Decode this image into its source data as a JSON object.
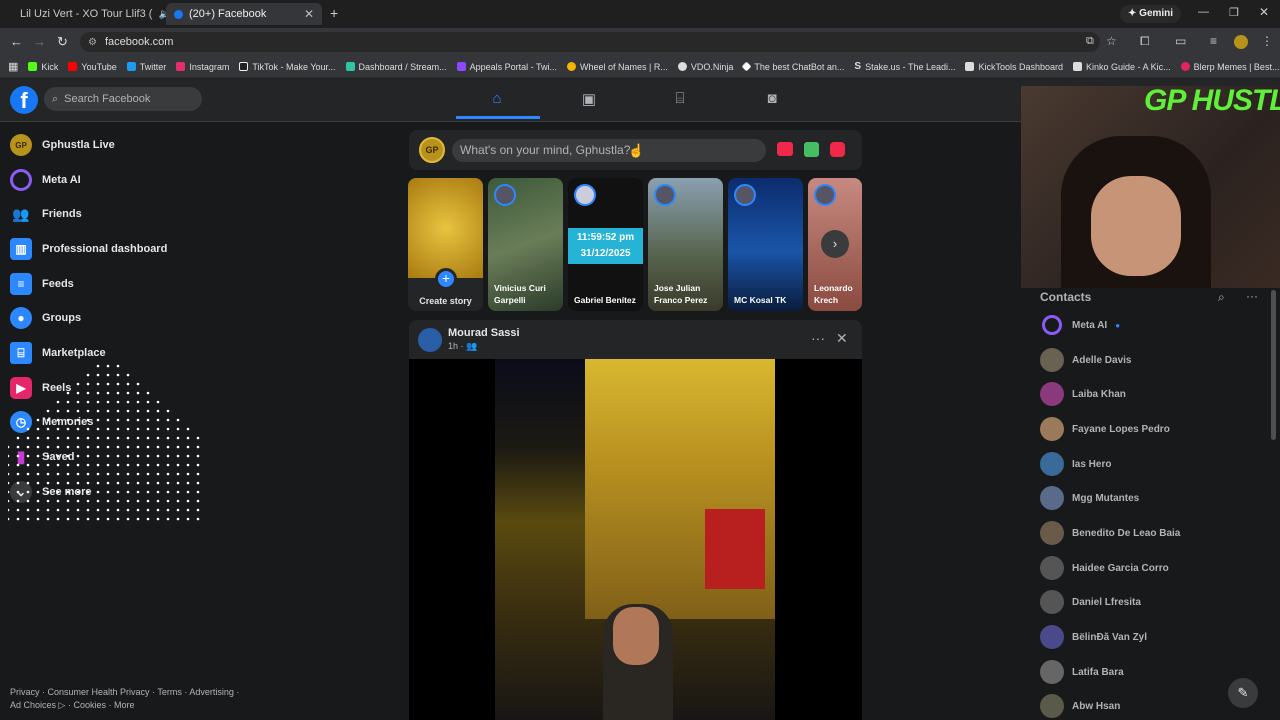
{
  "browser": {
    "tabs": [
      {
        "title": "Lil Uzi Vert - XO Tour Llif3 (",
        "active": false
      },
      {
        "title": "(20+) Facebook",
        "active": true
      }
    ],
    "gemini_label": "Gemini",
    "url": "facebook.com",
    "bookmarks": [
      "Kick",
      "YouTube",
      "Twitter",
      "Instagram",
      "TikTok - Make Your...",
      "Dashboard / Stream...",
      "Appeals Portal - Twi...",
      "Wheel of Names | R...",
      "VDO.Ninja",
      "The best ChatBot an...",
      "Stake.us - The Leadi...",
      "KickTools Dashboard",
      "Kinko Guide - A Kic...",
      "Blerp Memes | Best..."
    ]
  },
  "header": {
    "logo": "f",
    "search_placeholder": "Search Facebook"
  },
  "sidebar": {
    "items": [
      "Gphustla Live",
      "Meta AI",
      "Friends",
      "Professional dashboard",
      "Feeds",
      "Groups",
      "Marketplace",
      "Reels",
      "Memories",
      "Saved",
      "See more"
    ]
  },
  "footer": {
    "line1": "Privacy · Consumer Health Privacy · Terms · Advertising ·",
    "line2": "Ad Choices ▷ · Cookies · More"
  },
  "composer": {
    "avatar": "GP",
    "placeholder": "What's on your mind, Gphustla?"
  },
  "stories": [
    {
      "name": "Create story"
    },
    {
      "name": "Vinicius Curi Garpelli"
    },
    {
      "name": "Gabriel Benítez",
      "time": "11:59:52 pm",
      "date": "31/12/2025"
    },
    {
      "name": "Jose Julian Franco Perez"
    },
    {
      "name": "MC Kosal TK"
    },
    {
      "name": "Leonardo Krech"
    }
  ],
  "post": {
    "author": "Mourad Sassi",
    "time": "1h ·"
  },
  "stream": {
    "overlay_title": "GP HUSTLA"
  },
  "contacts": {
    "heading": "Contacts",
    "list": [
      "Meta AI",
      "Adelle Davis",
      "Laiba Khan",
      "Fayane Lopes Pedro",
      "Ias Hero",
      "Mgg Mutantes",
      "Benedito De Leao Baia",
      "Haidee Garcia Corro",
      "Daniel Lfresita",
      "BëlinĐă Van Zyl",
      "Latifa Bara",
      "Abw Hsan"
    ]
  },
  "colors": {
    "accent": "#2d88ff",
    "bg": "#18191a",
    "card": "#242526",
    "stream_title": "#5ff03a"
  }
}
